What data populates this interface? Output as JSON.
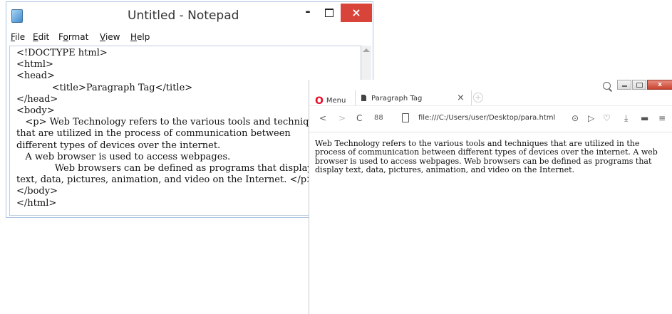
{
  "notepad": {
    "title": "Untitled - Notepad",
    "close_glyph": "×",
    "minimize_glyph": "-",
    "menu": [
      {
        "underline": "F",
        "rest": "ile"
      },
      {
        "underline": "E",
        "rest": "dit"
      },
      {
        "underline": "o",
        "pre": "F",
        "rest": "rmat"
      },
      {
        "underline": "V",
        "rest": "iew"
      },
      {
        "underline": "H",
        "rest": "elp"
      }
    ],
    "lines": [
      "<!DOCTYPE html>",
      "<html>",
      "<head>",
      "            <title>Paragraph Tag</title>",
      "</head>",
      "<body>",
      "   <p> Web Technology refers to the various tools and techniques",
      "that are utilized in the process of communication between",
      "different types of devices over the internet.",
      "   A web browser is used to access webpages.",
      "             Web browsers can be defined as programs that display",
      "text, data, pictures, animation, and video on the Internet. </p>",
      "</body>",
      "</html>"
    ]
  },
  "browser": {
    "menu_label": "Menu",
    "tab_label": "Paragraph Tag",
    "tab_close": "×",
    "new_tab": "+",
    "close_glyph": "x",
    "toolbar": {
      "back": "<",
      "forward": ">",
      "reload": "C",
      "speed_dial": "88",
      "snapshot": "⊙",
      "send": "▷",
      "heart": "♡",
      "download": "⤓",
      "battery": "▬",
      "menu": "≡"
    },
    "url": "file:///C:/Users/user/Desktop/para.html",
    "paragraph": "Web Technology refers to the various tools and techniques that are utilized in the process of communication between different types of devices over the internet. A web browser is used to access webpages. Web browsers can be defined as programs that display text, data, pictures, animation, and video on the Internet."
  },
  "colors": {
    "notepad_close": "#d9443a",
    "opera_red": "#e8112d"
  }
}
